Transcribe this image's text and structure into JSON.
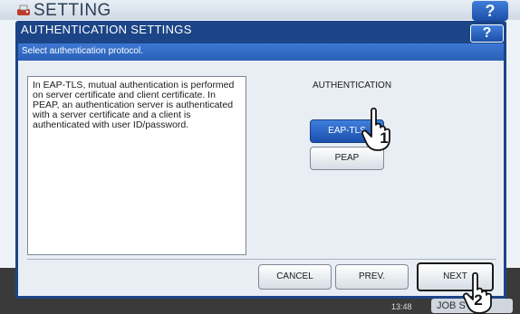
{
  "background": {
    "title": "SETTING",
    "help_label": "?",
    "time": "13:48",
    "job_button": "JOB S"
  },
  "dialog": {
    "title": "AUTHENTICATION SETTINGS",
    "help_label": "?",
    "instruction": "Select authentication protocol.",
    "description": "In EAP-TLS, mutual authentication is performed on server certificate and client certificate. In PEAP, an authentication server is authenticated with a server certificate and a client is authenticated with user ID/password.",
    "authentication_label": "AUTHENTICATION",
    "options": [
      "EAP-TLS",
      "PEAP"
    ],
    "selected": "EAP-TLS",
    "buttons": {
      "cancel": "CANCEL",
      "prev": "PREV.",
      "next": "NEXT"
    }
  },
  "annotations": {
    "step1": "1",
    "step2": "2"
  },
  "colors": {
    "title_bar": "#1c4587",
    "instruction_bar": "#2f66be",
    "selected_button": "#2a5fc0"
  }
}
